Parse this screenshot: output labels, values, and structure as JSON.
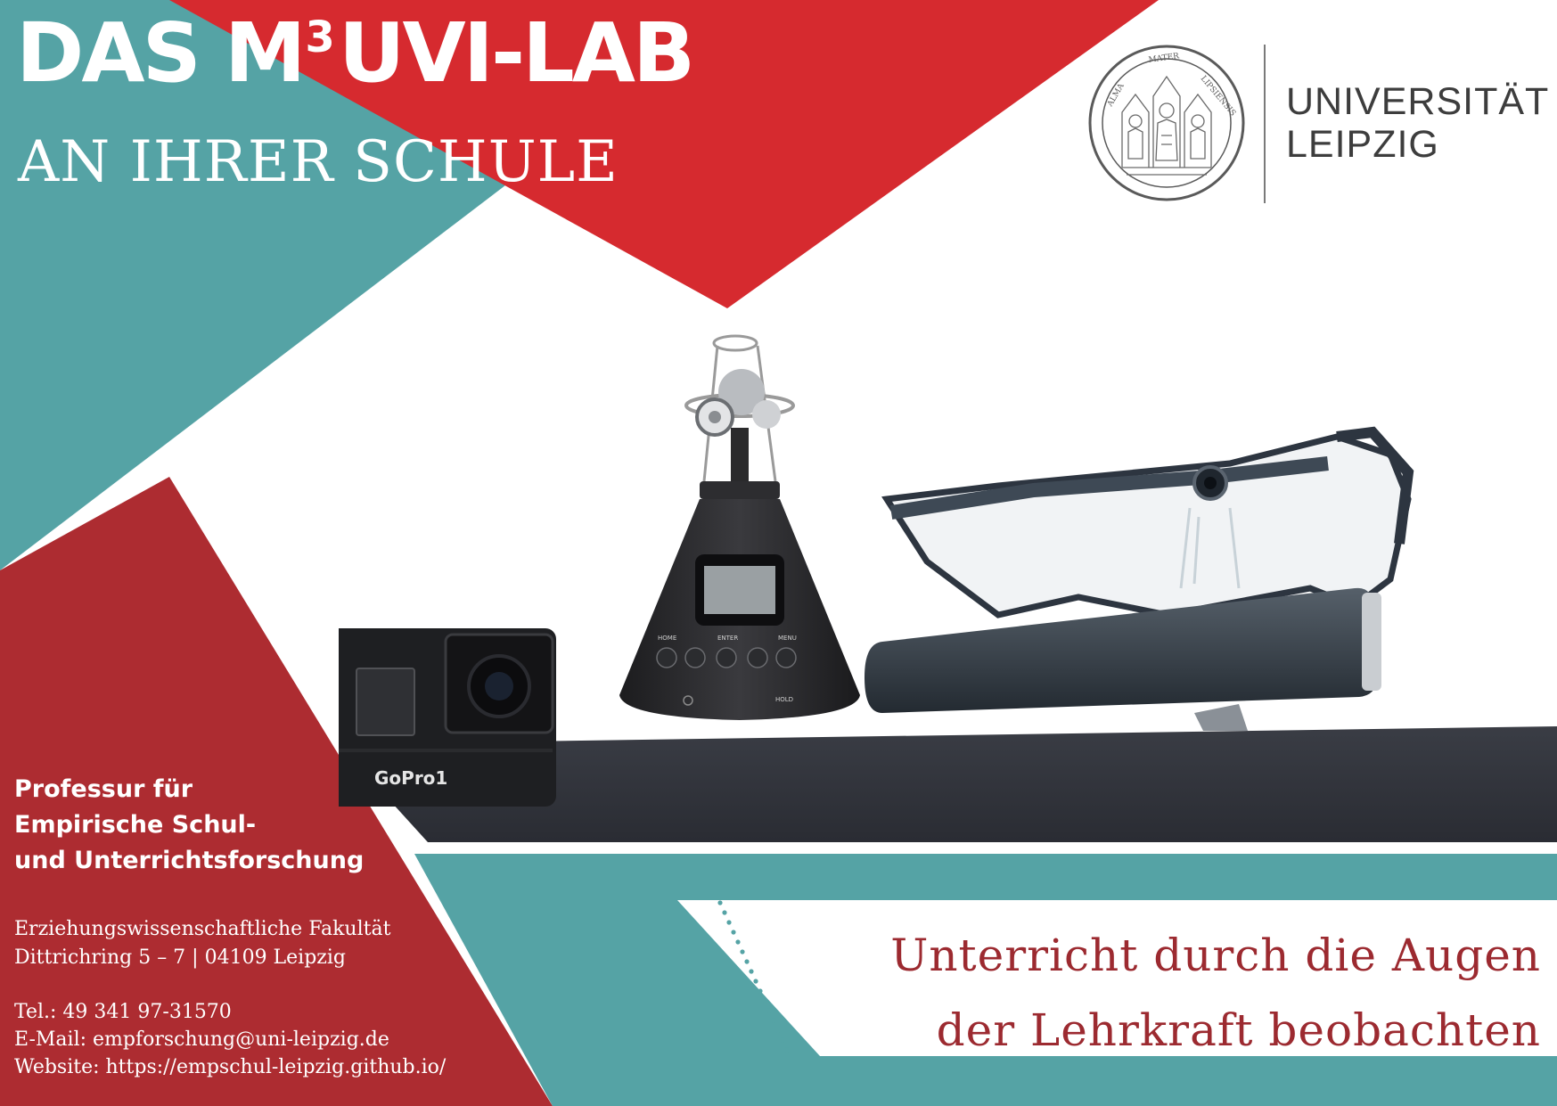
{
  "colors": {
    "teal": "#55a3a5",
    "red": "#d62a2f",
    "dark_red": "#ad2c31",
    "white": "#ffffff",
    "tagline_text": "#9c2a30",
    "logo_text": "#3d3d3d"
  },
  "header": {
    "title_prefix": "DAS M",
    "title_superscript": "3",
    "title_suffix": "UVI-LAB",
    "subtitle": "AN IHRER SCHULE"
  },
  "logo": {
    "line1": "UNIVERSITÄT",
    "line2": "LEIPZIG",
    "seal_icon": "university-seal-icon",
    "seal_lettering": "ALMA MATER LIPSIENSIS"
  },
  "photo": {
    "gopro_label": "GoPro1",
    "recorder_buttons": [
      "HOME",
      "ENTER",
      "MENU"
    ],
    "recorder_hold": "HOLD"
  },
  "institute": {
    "lines": [
      "Professur für",
      "Empirische Schul-",
      "und Unterrichtsforschung"
    ]
  },
  "address": {
    "faculty": "Erziehungswissenschaftliche Fakultät",
    "street": "Dittrichring 5 – 7 | 04109 Leipzig"
  },
  "contact": {
    "phone": "Tel.: 49 341 97-31570",
    "email": "E-Mail: empforschung@uni-leipzig.de",
    "website": "Website: https://empschul-leipzig.github.io/"
  },
  "tagline": {
    "line1": "Unterricht durch die Augen",
    "line2": "der Lehrkraft beobachten"
  }
}
